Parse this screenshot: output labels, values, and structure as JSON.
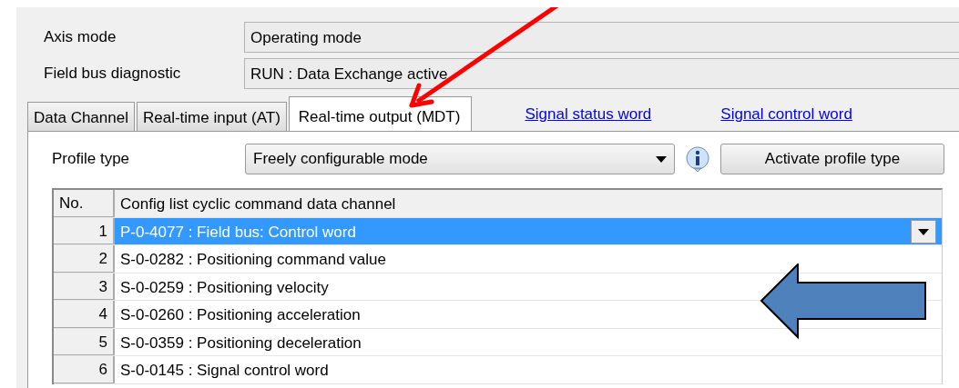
{
  "fields": [
    {
      "label": "Axis mode",
      "value": "Operating mode"
    },
    {
      "label": "Field bus diagnostic",
      "value": "RUN : Data Exchange active"
    }
  ],
  "tabs": [
    {
      "label": "Data Channel",
      "selected": false
    },
    {
      "label": "Real-time input (AT)",
      "selected": false
    },
    {
      "label": "Real-time output (MDT)",
      "selected": true
    }
  ],
  "links": [
    "Signal status word",
    "Signal control word"
  ],
  "profile_type": {
    "label": "Profile type",
    "value": "Freely configurable mode"
  },
  "activate_button": "Activate profile type",
  "table": {
    "columns": [
      "No.",
      "Config list cyclic command data channel"
    ],
    "rows": [
      {
        "no": "1",
        "parameter": "P-0-4077 : Field bus: Control word",
        "selected": true
      },
      {
        "no": "2",
        "parameter": "S-0-0282 : Positioning command value",
        "selected": false
      },
      {
        "no": "3",
        "parameter": "S-0-0259 : Positioning velocity",
        "selected": false
      },
      {
        "no": "4",
        "parameter": "S-0-0260 : Positioning acceleration",
        "selected": false
      },
      {
        "no": "5",
        "parameter": "S-0-0359 : Positioning deceleration",
        "selected": false
      },
      {
        "no": "6",
        "parameter": "S-0-0145 : Signal control word",
        "selected": false
      }
    ]
  }
}
